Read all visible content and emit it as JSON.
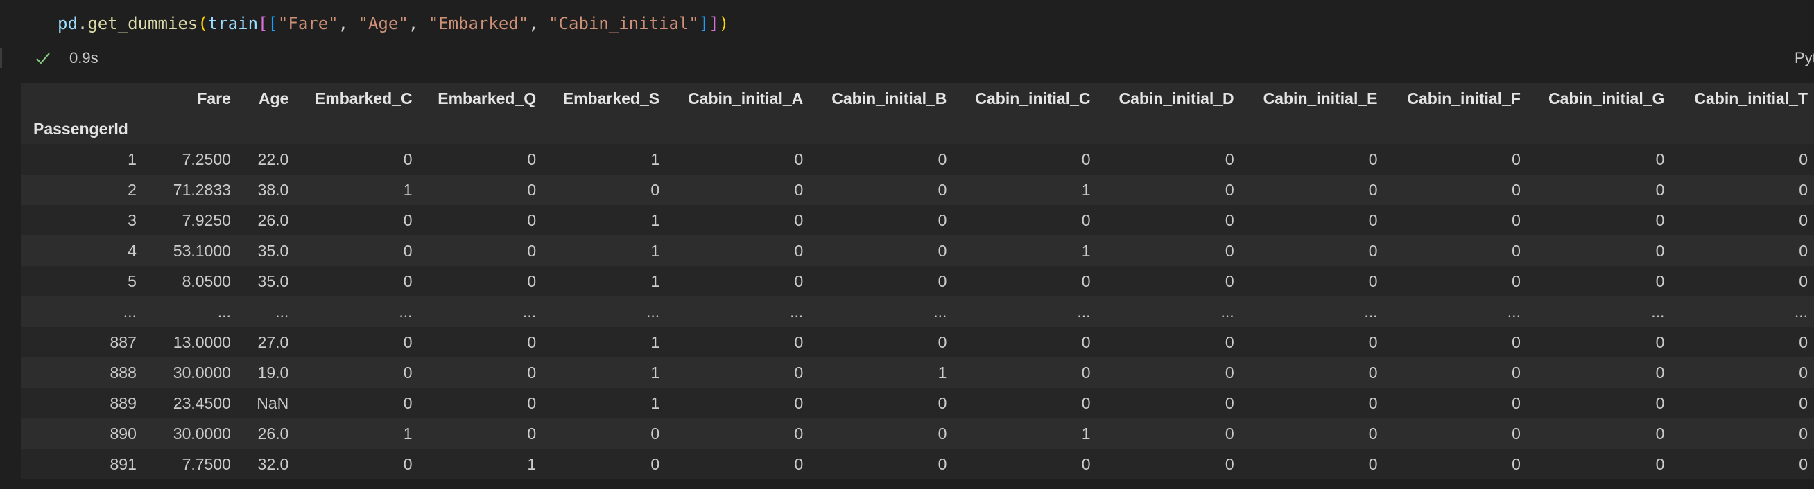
{
  "code": {
    "tokens": [
      {
        "text": "pd",
        "cls": "tok-var"
      },
      {
        "text": ".",
        "cls": "tok-pun"
      },
      {
        "text": "get_dummies",
        "cls": "tok-fn"
      },
      {
        "text": "(",
        "cls": "tok-p1"
      },
      {
        "text": "train",
        "cls": "tok-var"
      },
      {
        "text": "[",
        "cls": "tok-p2"
      },
      {
        "text": "[",
        "cls": "tok-p3"
      },
      {
        "text": "\"Fare\"",
        "cls": "tok-str"
      },
      {
        "text": ", ",
        "cls": "tok-pun"
      },
      {
        "text": "\"Age\"",
        "cls": "tok-str"
      },
      {
        "text": ", ",
        "cls": "tok-pun"
      },
      {
        "text": "\"Embarked\"",
        "cls": "tok-str"
      },
      {
        "text": ", ",
        "cls": "tok-pun"
      },
      {
        "text": "\"Cabin_initial\"",
        "cls": "tok-str"
      },
      {
        "text": "]",
        "cls": "tok-p3"
      },
      {
        "text": "]",
        "cls": "tok-p2"
      },
      {
        "text": ")",
        "cls": "tok-p1"
      }
    ]
  },
  "status": {
    "icon": "check-icon",
    "time": "0.9s",
    "language": "Python"
  },
  "colors": {
    "background": "#1f1f1f",
    "header_background": "#2b2b2b",
    "row_odd": "#262626",
    "row_even": "#2d2d2d",
    "check": "#89d185"
  },
  "table": {
    "index_name": "PassengerId",
    "columns": [
      "Fare",
      "Age",
      "Embarked_C",
      "Embarked_Q",
      "Embarked_S",
      "Cabin_initial_A",
      "Cabin_initial_B",
      "Cabin_initial_C",
      "Cabin_initial_D",
      "Cabin_initial_E",
      "Cabin_initial_F",
      "Cabin_initial_G",
      "Cabin_initial_T"
    ],
    "rows": [
      {
        "index": "1",
        "values": [
          "7.2500",
          "22.0",
          "0",
          "0",
          "1",
          "0",
          "0",
          "0",
          "0",
          "0",
          "0",
          "0",
          "0"
        ]
      },
      {
        "index": "2",
        "values": [
          "71.2833",
          "38.0",
          "1",
          "0",
          "0",
          "0",
          "0",
          "1",
          "0",
          "0",
          "0",
          "0",
          "0"
        ]
      },
      {
        "index": "3",
        "values": [
          "7.9250",
          "26.0",
          "0",
          "0",
          "1",
          "0",
          "0",
          "0",
          "0",
          "0",
          "0",
          "0",
          "0"
        ]
      },
      {
        "index": "4",
        "values": [
          "53.1000",
          "35.0",
          "0",
          "0",
          "1",
          "0",
          "0",
          "1",
          "0",
          "0",
          "0",
          "0",
          "0"
        ]
      },
      {
        "index": "5",
        "values": [
          "8.0500",
          "35.0",
          "0",
          "0",
          "1",
          "0",
          "0",
          "0",
          "0",
          "0",
          "0",
          "0",
          "0"
        ]
      },
      {
        "index": "...",
        "values": [
          "...",
          "...",
          "...",
          "...",
          "...",
          "...",
          "...",
          "...",
          "...",
          "...",
          "...",
          "...",
          "..."
        ]
      },
      {
        "index": "887",
        "values": [
          "13.0000",
          "27.0",
          "0",
          "0",
          "1",
          "0",
          "0",
          "0",
          "0",
          "0",
          "0",
          "0",
          "0"
        ]
      },
      {
        "index": "888",
        "values": [
          "30.0000",
          "19.0",
          "0",
          "0",
          "1",
          "0",
          "1",
          "0",
          "0",
          "0",
          "0",
          "0",
          "0"
        ]
      },
      {
        "index": "889",
        "values": [
          "23.4500",
          "NaN",
          "0",
          "0",
          "1",
          "0",
          "0",
          "0",
          "0",
          "0",
          "0",
          "0",
          "0"
        ]
      },
      {
        "index": "890",
        "values": [
          "30.0000",
          "26.0",
          "1",
          "0",
          "0",
          "0",
          "0",
          "1",
          "0",
          "0",
          "0",
          "0",
          "0"
        ]
      },
      {
        "index": "891",
        "values": [
          "7.7500",
          "32.0",
          "0",
          "1",
          "0",
          "0",
          "0",
          "0",
          "0",
          "0",
          "0",
          "0",
          "0"
        ]
      }
    ]
  }
}
